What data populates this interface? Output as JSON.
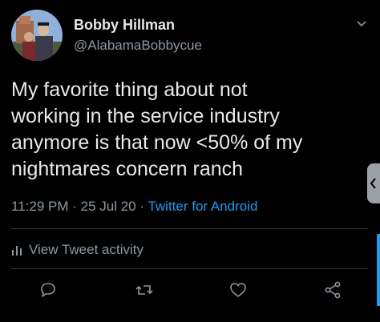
{
  "tweet": {
    "author": {
      "display_name": "Bobby Hillman",
      "handle": "@AlabamaBobbycue"
    },
    "text": "My favorite thing about not\nworking in the service industry\nanymore is that now <50% of my\nnightmares concern ranch",
    "meta": {
      "time": "11:29 PM",
      "separator": " · ",
      "date": "25 Jul 20",
      "source": "Twitter for Android"
    },
    "activity_label": "View Tweet activity"
  },
  "icons": {
    "caret": "chevron-down-icon",
    "activity": "bar-chart-icon",
    "reply": "reply-icon",
    "retweet": "retweet-icon",
    "like": "heart-icon",
    "share": "share-icon",
    "side_tab": "chevron-left-icon"
  },
  "colors": {
    "background": "#000000",
    "primary_text": "#e7e9ea",
    "secondary_text": "#8b98a5",
    "accent": "#1d9bf0",
    "divider": "#2f3336"
  }
}
